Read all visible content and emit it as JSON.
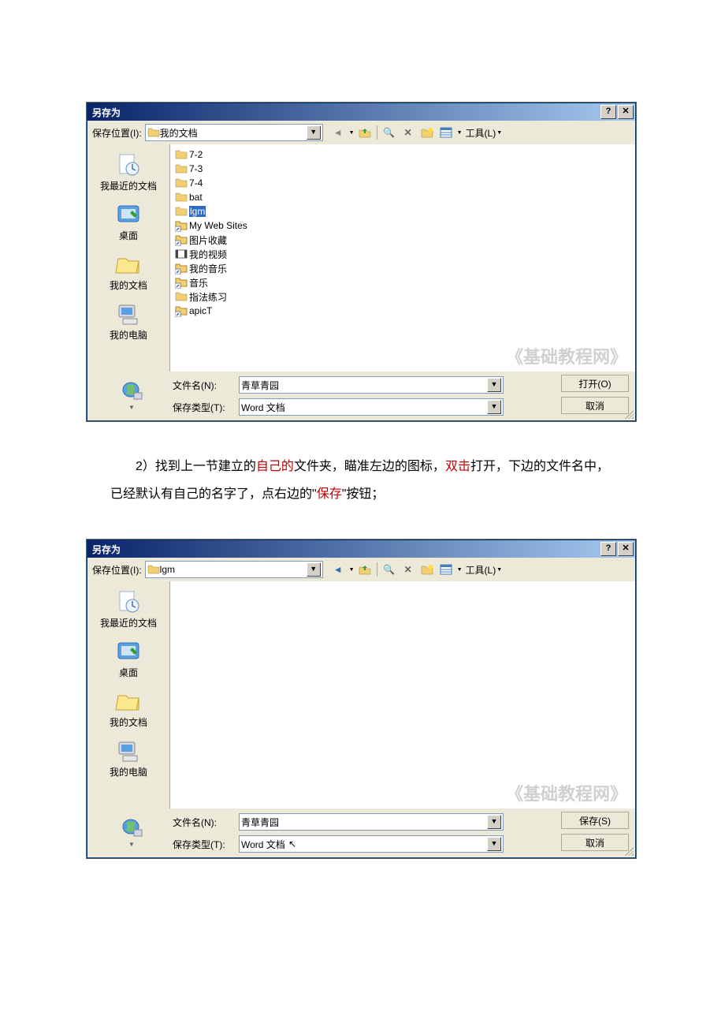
{
  "dialog1": {
    "title": "另存为",
    "helpGlyph": "?",
    "closeGlyph": "✕",
    "locationLabel": "保存位置(I):",
    "locationValue": "我的文档",
    "toolsLabel": "工具(L)",
    "sidebar": [
      {
        "label": "我最近的文档"
      },
      {
        "label": "桌面"
      },
      {
        "label": "我的文档"
      },
      {
        "label": "我的电脑"
      }
    ],
    "files": [
      {
        "name": "7-2",
        "type": "folder"
      },
      {
        "name": "7-3",
        "type": "folder"
      },
      {
        "name": "7-4",
        "type": "folder"
      },
      {
        "name": "bat",
        "type": "folder"
      },
      {
        "name": "lgm",
        "type": "folder",
        "selected": true
      },
      {
        "name": "My Web Sites",
        "type": "shortcut"
      },
      {
        "name": "图片收藏",
        "type": "shortcut"
      },
      {
        "name": "我的视频",
        "type": "video"
      },
      {
        "name": "我的音乐",
        "type": "shortcut"
      },
      {
        "name": "音乐",
        "type": "shortcut"
      },
      {
        "name": "指法练习",
        "type": "folder"
      },
      {
        "name": "apicT",
        "type": "shortcut"
      }
    ],
    "watermark": "《基础教程网》",
    "filenameLabel": "文件名(N):",
    "filenameValue": "青草青园",
    "typeLabel": "保存类型(T):",
    "typeValue": "Word 文档",
    "primaryBtn": "打开(O)",
    "cancelBtn": "取消"
  },
  "bodyText": {
    "prefix": "　　2）找到上一节建立的",
    "r1": "自己的",
    "mid1": "文件夹，瞄准左边的图标，",
    "r2": "双击",
    "mid2": "打开，下边的文件名中，已经默认有自己的名字了，点右边的\"",
    "r3": "保存",
    "suffix": "\"按钮；"
  },
  "dialog2": {
    "title": "另存为",
    "helpGlyph": "?",
    "closeGlyph": "✕",
    "locationLabel": "保存位置(I):",
    "locationValue": "lgm",
    "toolsLabel": "工具(L)",
    "sidebar": [
      {
        "label": "我最近的文档"
      },
      {
        "label": "桌面"
      },
      {
        "label": "我的文档"
      },
      {
        "label": "我的电脑"
      }
    ],
    "watermark": "《基础教程网》",
    "filenameLabel": "文件名(N):",
    "filenameValue": "青草青园",
    "typeLabel": "保存类型(T):",
    "typeValue": "Word 文档",
    "primaryBtn": "保存(S)",
    "cancelBtn": "取消"
  }
}
